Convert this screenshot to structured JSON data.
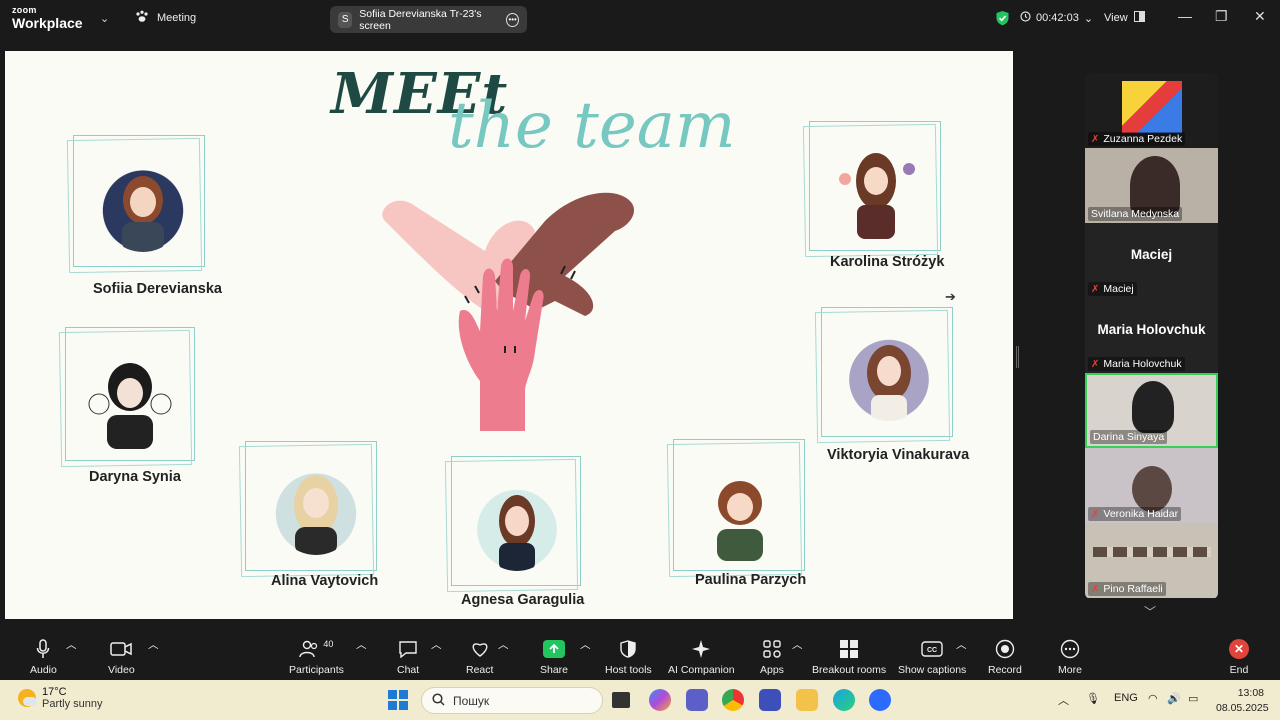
{
  "app": {
    "logo_small": "zoom",
    "logo_big": "Workplace",
    "meeting_label": "Meeting",
    "share_pill_initial": "S",
    "share_pill_label": "Sofiia Derevianska Tr-23's screen",
    "timer": "00:42:03",
    "view_label": "View"
  },
  "slide": {
    "title_meet": "MEEt",
    "title_team": "the team",
    "members": [
      {
        "name": "Sofiia Derevianska"
      },
      {
        "name": "Daryna Synia"
      },
      {
        "name": "Alina Vaytovich"
      },
      {
        "name": "Agnesa Garagulia"
      },
      {
        "name": "Paulina Parzych"
      },
      {
        "name": "Karolina Stróżyk"
      },
      {
        "name": "Viktoryia Vinakurava"
      }
    ]
  },
  "gallery": {
    "tiles": [
      {
        "label": "Zuzanna Pezdek",
        "muted": true,
        "big_name": ""
      },
      {
        "label": "Svitlana Medynska",
        "muted": false,
        "big_name": ""
      },
      {
        "label": "Maciej",
        "muted": true,
        "big_name": "Maciej"
      },
      {
        "label": "Maria Holovchuk",
        "muted": true,
        "big_name": "Maria Holovchuk"
      },
      {
        "label": "Darina Sinyaya",
        "muted": false,
        "big_name": "",
        "active": true
      },
      {
        "label": "Veronika Haidar",
        "muted": true,
        "big_name": ""
      },
      {
        "label": "Pino Raffaeli",
        "muted": true,
        "big_name": ""
      }
    ]
  },
  "toolbar": {
    "audio": "Audio",
    "video": "Video",
    "participants": "Participants",
    "participants_count": "40",
    "chat": "Chat",
    "react": "React",
    "share": "Share",
    "host_tools": "Host tools",
    "ai_companion": "AI Companion",
    "apps": "Apps",
    "breakout_rooms": "Breakout rooms",
    "show_captions": "Show captions",
    "record": "Record",
    "more": "More",
    "end": "End"
  },
  "taskbar": {
    "temperature": "17°C",
    "condition": "Partly sunny",
    "search_placeholder": "Пошук",
    "language": "ENG",
    "time": "13:08",
    "date": "08.05.2025"
  },
  "colors": {
    "accent_green": "#22c55e",
    "end_red": "#e0443a",
    "frame_teal": "#8fcfc9",
    "title_dark": "#1f4a44",
    "title_light": "#76c8c0"
  }
}
